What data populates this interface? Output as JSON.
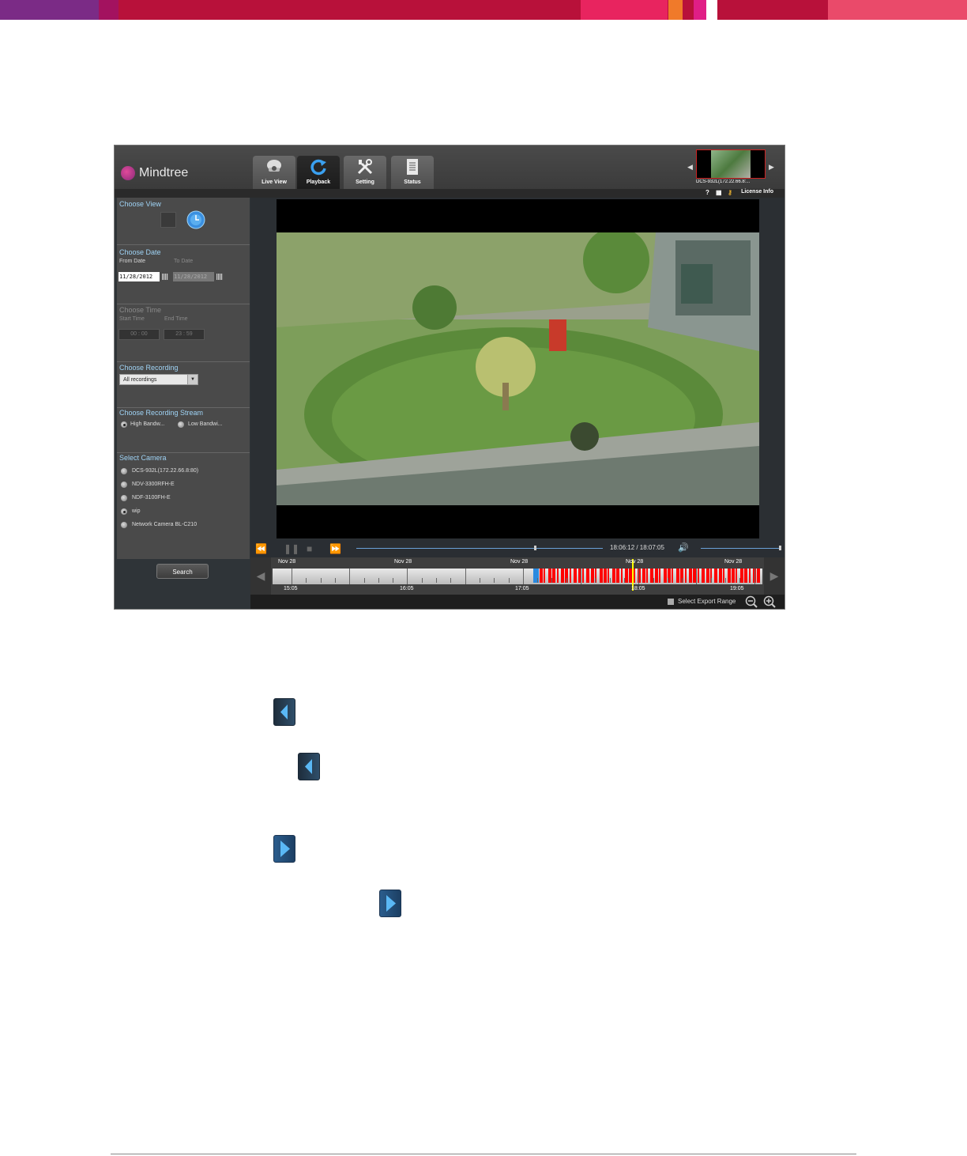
{
  "app": {
    "logo_text": "Mindtree",
    "tabs": [
      {
        "label": "Live View",
        "icon": "camera-dome-icon",
        "active": false
      },
      {
        "label": "Playback",
        "icon": "refresh-icon",
        "active": true
      },
      {
        "label": "Setting",
        "icon": "tools-icon",
        "active": false
      },
      {
        "label": "Status",
        "icon": "document-icon",
        "active": false
      }
    ],
    "camera_thumb_label": "DCS-932L(172.22.66.8:...",
    "license_info": "License Info"
  },
  "sidebar": {
    "choose_view": "Choose View",
    "choose_date": "Choose Date",
    "from_date_label": "From Date",
    "to_date_label": "To Date",
    "from_date": "11/28/2012",
    "to_date": "11/28/2012",
    "choose_time": "Choose Time",
    "start_time_label": "Start Time",
    "end_time_label": "End Time",
    "start_time": "00 : 00",
    "end_time": "23 : 59",
    "choose_recording": "Choose Recording",
    "recording_selected": "All recordings",
    "choose_stream": "Choose Recording Stream",
    "stream_high": "High Bandw...",
    "stream_low": "Low Bandwi...",
    "select_camera": "Select Camera",
    "cameras": [
      {
        "label": "DCS-932L(172.22.66.8:80)",
        "selected": false
      },
      {
        "label": "NDV-3300RFH-E",
        "selected": false
      },
      {
        "label": "NDF-3100FH-E",
        "selected": false
      },
      {
        "label": "wip",
        "selected": true
      },
      {
        "label": "Network Camera BL-C210",
        "selected": false
      }
    ],
    "search_button": "Search"
  },
  "player": {
    "time_display": "18:06:12 / 18:07:05",
    "progress": 0.72,
    "volume": 1.0
  },
  "timeline": {
    "date_labels": [
      "Nov 28",
      "Nov 28",
      "Nov 28",
      "Nov 28",
      "Nov 28"
    ],
    "time_labels": [
      "15:05",
      "16:05",
      "17:05",
      "18:05",
      "19:05"
    ],
    "export_label": "Select Export Range"
  },
  "colors": {
    "banner": "#b8113a",
    "accent": "#9fd3f5",
    "recording": "#ff0000",
    "cursor": "#ffff00"
  }
}
